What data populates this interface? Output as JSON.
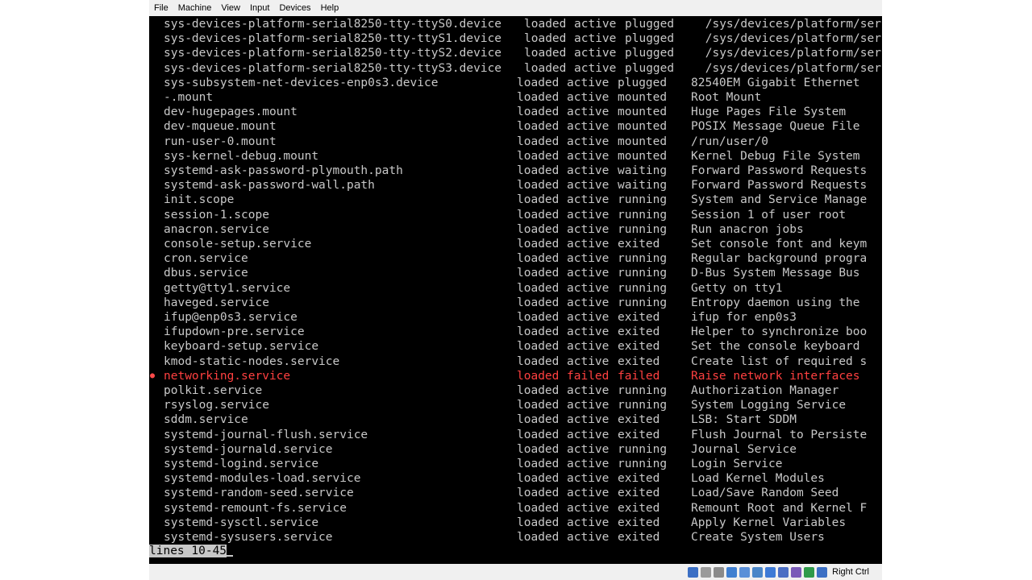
{
  "menu": [
    "File",
    "Machine",
    "View",
    "Input",
    "Devices",
    "Help"
  ],
  "rows": [
    {
      "unit": "sys-devices-platform-serial8250-tty-ttyS0.device",
      "load": "loaded",
      "active": "active",
      "sub": "plugged",
      "desc": " /sys/devices/platform/ser",
      "wide": true
    },
    {
      "unit": "sys-devices-platform-serial8250-tty-ttyS1.device",
      "load": "loaded",
      "active": "active",
      "sub": "plugged",
      "desc": " /sys/devices/platform/ser",
      "wide": true
    },
    {
      "unit": "sys-devices-platform-serial8250-tty-ttyS2.device",
      "load": "loaded",
      "active": "active",
      "sub": "plugged",
      "desc": " /sys/devices/platform/ser",
      "wide": true
    },
    {
      "unit": "sys-devices-platform-serial8250-tty-ttyS3.device",
      "load": "loaded",
      "active": "active",
      "sub": "plugged",
      "desc": " /sys/devices/platform/ser",
      "wide": true
    },
    {
      "unit": "sys-subsystem-net-devices-enp0s3.device",
      "load": "loaded",
      "active": "active",
      "sub": "plugged",
      "desc": "82540EM Gigabit Ethernet"
    },
    {
      "unit": "-.mount",
      "load": "loaded",
      "active": "active",
      "sub": "mounted",
      "desc": "Root Mount"
    },
    {
      "unit": "dev-hugepages.mount",
      "load": "loaded",
      "active": "active",
      "sub": "mounted",
      "desc": "Huge Pages File System"
    },
    {
      "unit": "dev-mqueue.mount",
      "load": "loaded",
      "active": "active",
      "sub": "mounted",
      "desc": "POSIX Message Queue File"
    },
    {
      "unit": "run-user-0.mount",
      "load": "loaded",
      "active": "active",
      "sub": "mounted",
      "desc": "/run/user/0"
    },
    {
      "unit": "sys-kernel-debug.mount",
      "load": "loaded",
      "active": "active",
      "sub": "mounted",
      "desc": "Kernel Debug File System"
    },
    {
      "unit": "systemd-ask-password-plymouth.path",
      "load": "loaded",
      "active": "active",
      "sub": "waiting",
      "desc": "Forward Password Requests"
    },
    {
      "unit": "systemd-ask-password-wall.path",
      "load": "loaded",
      "active": "active",
      "sub": "waiting",
      "desc": "Forward Password Requests"
    },
    {
      "unit": "init.scope",
      "load": "loaded",
      "active": "active",
      "sub": "running",
      "desc": "System and Service Manage"
    },
    {
      "unit": "session-1.scope",
      "load": "loaded",
      "active": "active",
      "sub": "running",
      "desc": "Session 1 of user root"
    },
    {
      "unit": "anacron.service",
      "load": "loaded",
      "active": "active",
      "sub": "running",
      "desc": "Run anacron jobs"
    },
    {
      "unit": "console-setup.service",
      "load": "loaded",
      "active": "active",
      "sub": "exited",
      "desc": "Set console font and keym"
    },
    {
      "unit": "cron.service",
      "load": "loaded",
      "active": "active",
      "sub": "running",
      "desc": "Regular background progra"
    },
    {
      "unit": "dbus.service",
      "load": "loaded",
      "active": "active",
      "sub": "running",
      "desc": "D-Bus System Message Bus"
    },
    {
      "unit": "getty@tty1.service",
      "load": "loaded",
      "active": "active",
      "sub": "running",
      "desc": "Getty on tty1"
    },
    {
      "unit": "haveged.service",
      "load": "loaded",
      "active": "active",
      "sub": "running",
      "desc": "Entropy daemon using the"
    },
    {
      "unit": "ifup@enp0s3.service",
      "load": "loaded",
      "active": "active",
      "sub": "exited",
      "desc": "ifup for enp0s3"
    },
    {
      "unit": "ifupdown-pre.service",
      "load": "loaded",
      "active": "active",
      "sub": "exited",
      "desc": "Helper to synchronize boo"
    },
    {
      "unit": "keyboard-setup.service",
      "load": "loaded",
      "active": "active",
      "sub": "exited",
      "desc": "Set the console keyboard"
    },
    {
      "unit": "kmod-static-nodes.service",
      "load": "loaded",
      "active": "active",
      "sub": "exited",
      "desc": "Create list of required s"
    },
    {
      "unit": "networking.service",
      "load": "loaded",
      "active": "failed",
      "sub": "failed",
      "desc": "Raise network interfaces",
      "failed": true
    },
    {
      "unit": "polkit.service",
      "load": "loaded",
      "active": "active",
      "sub": "running",
      "desc": "Authorization Manager"
    },
    {
      "unit": "rsyslog.service",
      "load": "loaded",
      "active": "active",
      "sub": "running",
      "desc": "System Logging Service"
    },
    {
      "unit": "sddm.service",
      "load": "loaded",
      "active": "active",
      "sub": "exited",
      "desc": "LSB: Start SDDM"
    },
    {
      "unit": "systemd-journal-flush.service",
      "load": "loaded",
      "active": "active",
      "sub": "exited",
      "desc": "Flush Journal to Persiste"
    },
    {
      "unit": "systemd-journald.service",
      "load": "loaded",
      "active": "active",
      "sub": "running",
      "desc": "Journal Service"
    },
    {
      "unit": "systemd-logind.service",
      "load": "loaded",
      "active": "active",
      "sub": "running",
      "desc": "Login Service"
    },
    {
      "unit": "systemd-modules-load.service",
      "load": "loaded",
      "active": "active",
      "sub": "exited",
      "desc": "Load Kernel Modules"
    },
    {
      "unit": "systemd-random-seed.service",
      "load": "loaded",
      "active": "active",
      "sub": "exited",
      "desc": "Load/Save Random Seed"
    },
    {
      "unit": "systemd-remount-fs.service",
      "load": "loaded",
      "active": "active",
      "sub": "exited",
      "desc": "Remount Root and Kernel F"
    },
    {
      "unit": "systemd-sysctl.service",
      "load": "loaded",
      "active": "active",
      "sub": "exited",
      "desc": "Apply Kernel Variables"
    },
    {
      "unit": "systemd-sysusers.service",
      "load": "loaded",
      "active": "active",
      "sub": "exited",
      "desc": "Create System Users"
    }
  ],
  "failed_marker": "●",
  "pager": {
    "prompt": "lines 10-45"
  },
  "statusbar": {
    "host_key": "Right Ctrl",
    "icons": [
      "harddisk-icon",
      "optical-drive-icon",
      "audio-icon",
      "network-icon",
      "usb-icon",
      "shared-folders-icon",
      "display-icon",
      "video-capture-icon",
      "virtualization-icon",
      "mouse-integration-icon",
      "keyboard-icon"
    ],
    "icon_colors": [
      "#3b6fc4",
      "#9a9a9a",
      "#8a8a8a",
      "#3f7fd0",
      "#5a8fd8",
      "#4a86c8",
      "#3d7ad6",
      "#4b6ec4",
      "#7a5ab8",
      "#2f9a4a",
      "#3b6fc4"
    ]
  },
  "colors": {
    "background": "#000000",
    "text": "#c8c8c8",
    "failed": "#ff4040",
    "chrome": "#f0f0f0"
  }
}
